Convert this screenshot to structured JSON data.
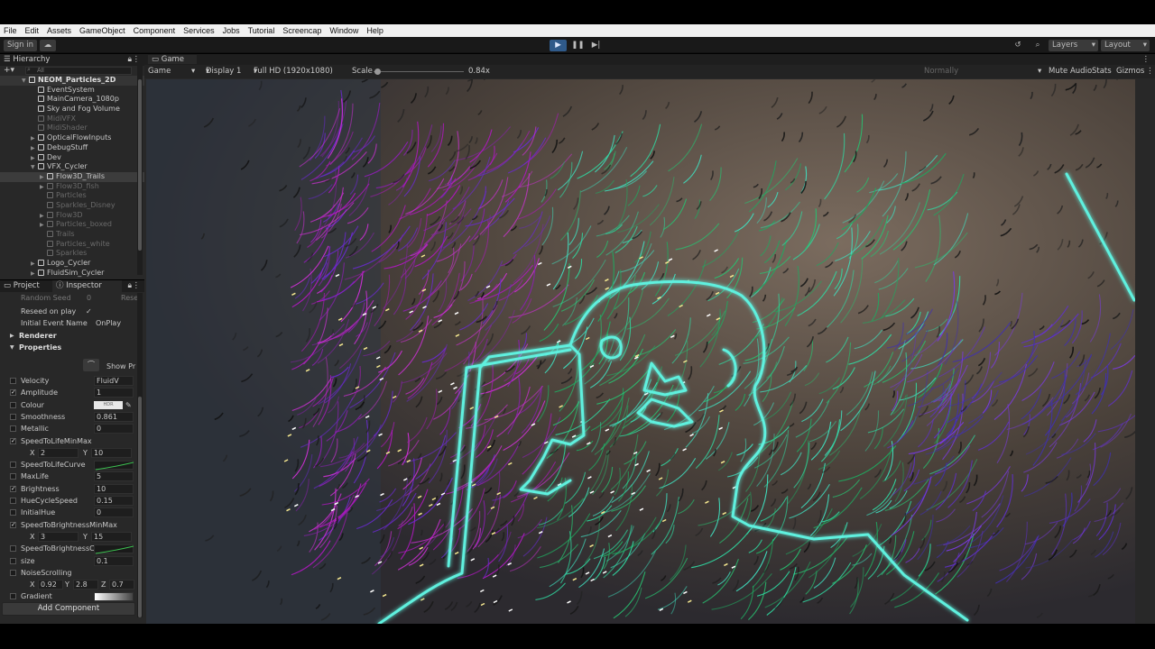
{
  "menu": [
    "File",
    "Edit",
    "Assets",
    "GameObject",
    "Component",
    "Services",
    "Jobs",
    "Tutorial",
    "Screencap",
    "Window",
    "Help"
  ],
  "toolbar": {
    "sign_in": "Sign in",
    "layers": "Layers",
    "layout": "Layout"
  },
  "hierarchy": {
    "tab": "Hierarchy",
    "search_placeholder": "All",
    "scene": "NEOM_Particles_2D",
    "items": [
      {
        "label": "EventSystem",
        "dim": false,
        "sel": false,
        "indent": 1,
        "arrow": ""
      },
      {
        "label": "MainCamera_1080p",
        "dim": false,
        "sel": false,
        "indent": 1,
        "arrow": ""
      },
      {
        "label": "Sky and Fog Volume",
        "dim": false,
        "sel": false,
        "indent": 1,
        "arrow": ""
      },
      {
        "label": "MidiVFX",
        "dim": true,
        "sel": false,
        "indent": 1,
        "arrow": ""
      },
      {
        "label": "MidiShader",
        "dim": true,
        "sel": false,
        "indent": 1,
        "arrow": ""
      },
      {
        "label": "OpticalFlowInputs",
        "dim": false,
        "sel": false,
        "indent": 1,
        "arrow": "▶"
      },
      {
        "label": "DebugStuff",
        "dim": false,
        "sel": false,
        "indent": 1,
        "arrow": "▶"
      },
      {
        "label": "Dev",
        "dim": false,
        "sel": false,
        "indent": 1,
        "arrow": "▶"
      },
      {
        "label": "VFX_Cycler",
        "dim": false,
        "sel": false,
        "indent": 1,
        "arrow": "▼"
      },
      {
        "label": "Flow3D_Trails",
        "dim": false,
        "sel": true,
        "indent": 2,
        "arrow": "▶"
      },
      {
        "label": "Flow3D_fish",
        "dim": true,
        "sel": false,
        "indent": 2,
        "arrow": "▶"
      },
      {
        "label": "Particles",
        "dim": true,
        "sel": false,
        "indent": 2,
        "arrow": ""
      },
      {
        "label": "Sparkles_Disney",
        "dim": true,
        "sel": false,
        "indent": 2,
        "arrow": ""
      },
      {
        "label": "Flow3D",
        "dim": true,
        "sel": false,
        "indent": 2,
        "arrow": "▶"
      },
      {
        "label": "Particles_boxed",
        "dim": true,
        "sel": false,
        "indent": 2,
        "arrow": "▶"
      },
      {
        "label": "Trails",
        "dim": true,
        "sel": false,
        "indent": 2,
        "arrow": ""
      },
      {
        "label": "Particles_white",
        "dim": true,
        "sel": false,
        "indent": 2,
        "arrow": ""
      },
      {
        "label": "Sparkles",
        "dim": true,
        "sel": false,
        "indent": 2,
        "arrow": ""
      },
      {
        "label": "Logo_Cycler",
        "dim": false,
        "sel": false,
        "indent": 1,
        "arrow": "▶"
      },
      {
        "label": "FluidSim_Cycler",
        "dim": false,
        "sel": false,
        "indent": 1,
        "arrow": "▶"
      }
    ]
  },
  "tabs": {
    "project": "Project",
    "inspector": "Inspector"
  },
  "inspector": {
    "random_seed": "Random Seed",
    "random_seed_val": "0",
    "random_seed_btn": "Rese",
    "reseed_on_play": "Reseed on play",
    "initial_event_name": "Initial Event Name",
    "initial_event_val": "OnPlay",
    "renderer": "Renderer",
    "properties": "Properties",
    "show_btn": "Show Pr",
    "rows": [
      {
        "label": "Velocity",
        "check": false,
        "val": "FluidV",
        "type": "field"
      },
      {
        "label": "Amplitude",
        "check": true,
        "val": "1",
        "type": "field"
      },
      {
        "label": "Colour",
        "check": false,
        "val": "HDR",
        "type": "color"
      },
      {
        "label": "Smoothness",
        "check": false,
        "val": "0.861",
        "type": "field"
      },
      {
        "label": "Metallic",
        "check": false,
        "val": "0",
        "type": "field"
      },
      {
        "label": "SpeedToLifeMinMax",
        "check": true,
        "val": "",
        "type": "none"
      },
      {
        "label": "",
        "check": false,
        "val": "",
        "type": "xy",
        "x": "2",
        "y": "10"
      },
      {
        "label": "SpeedToLifeCurve",
        "check": false,
        "val": "",
        "type": "curve"
      },
      {
        "label": "MaxLife",
        "check": false,
        "val": "5",
        "type": "field"
      },
      {
        "label": "Brightness",
        "check": true,
        "val": "10",
        "type": "field"
      },
      {
        "label": "HueCycleSpeed",
        "check": false,
        "val": "0.15",
        "type": "field"
      },
      {
        "label": "InitialHue",
        "check": false,
        "val": "0",
        "type": "field"
      },
      {
        "label": "SpeedToBrightnessMinMax",
        "check": true,
        "val": "",
        "type": "none"
      },
      {
        "label": "",
        "check": false,
        "val": "",
        "type": "xy",
        "x": "3",
        "y": "15"
      },
      {
        "label": "SpeedToBrightnessC",
        "check": false,
        "val": "",
        "type": "curve"
      },
      {
        "label": "size",
        "check": false,
        "val": "0.1",
        "type": "field"
      },
      {
        "label": "NoiseScrolling",
        "check": false,
        "val": "",
        "type": "none"
      },
      {
        "label": "",
        "check": false,
        "val": "",
        "type": "xyz",
        "x": "0.92",
        "y": "2.8",
        "z": "0.7"
      },
      {
        "label": "Gradient",
        "check": false,
        "val": "",
        "type": "gradient"
      }
    ],
    "add_component": "Add Component"
  },
  "game": {
    "tab": "Game",
    "mode": "Game",
    "display": "Display 1",
    "resolution": "Full HD (1920x1080)",
    "scale_label": "Scale",
    "scale_value": "0.84x",
    "normally": "Normally",
    "mute": "Mute Audio",
    "stats": "Stats",
    "gizmos": "Gizmos"
  },
  "colors": {
    "teal": "#3fe0c8",
    "magenta": "#c020c8",
    "green": "#30d080",
    "purple": "#6030d0",
    "bg": "#4a413a"
  }
}
